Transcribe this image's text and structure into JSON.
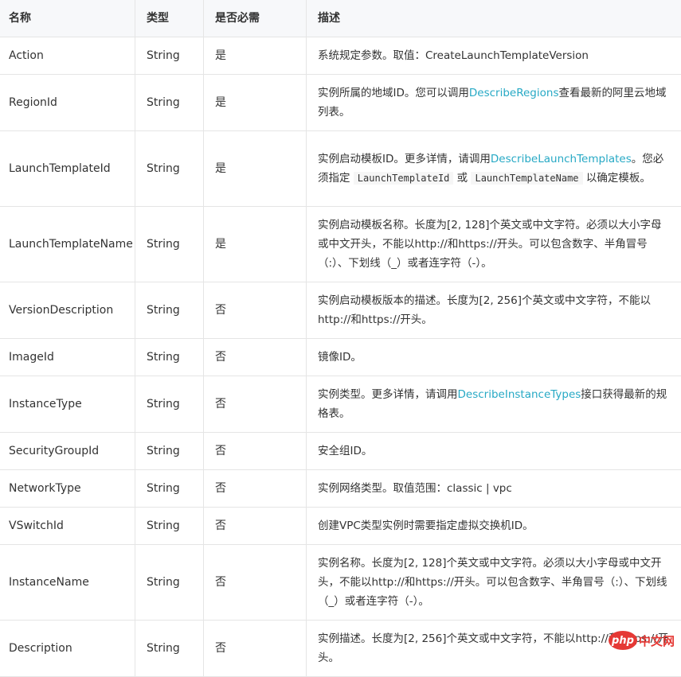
{
  "headers": [
    "名称",
    "类型",
    "是否必需",
    "描述"
  ],
  "rows": [
    {
      "name": "Action",
      "type": "String",
      "required": "是",
      "desc": [
        "系统规定参数。取值：CreateLaunchTemplateVersion"
      ]
    },
    {
      "name": "RegionId",
      "type": "String",
      "required": "是",
      "desc": [
        "实例所属的地域ID。您可以调用",
        {
          "link": "DescribeRegions"
        },
        "查看最新的阿里云地域列表。"
      ]
    },
    {
      "name": "LaunchTemplateId",
      "type": "String",
      "required": "是",
      "desc": [
        "实例启动模板ID。更多详情，请调用",
        {
          "link": "DescribeLaunchTemplates"
        },
        "。您必须指定 ",
        {
          "code": "LaunchTemplateId"
        },
        " 或 ",
        {
          "code": "LaunchTemplateName"
        },
        " 以确定模板。"
      ]
    },
    {
      "name": "LaunchTemplateName",
      "type": "String",
      "required": "是",
      "desc": [
        "实例启动模板名称。长度为[2, 128]个英文或中文字符。必须以大小字母或中文开头，不能以http://和https://开头。可以包含数字、半角冒号（:）、下划线（_）或者连字符（-）。"
      ]
    },
    {
      "name": "VersionDescription",
      "type": "String",
      "required": "否",
      "desc": [
        "实例启动模板版本的描述。长度为[2, 256]个英文或中文字符，不能以http://和https://开头。"
      ]
    },
    {
      "name": "ImageId",
      "type": "String",
      "required": "否",
      "desc": [
        "镜像ID。"
      ]
    },
    {
      "name": "InstanceType",
      "type": "String",
      "required": "否",
      "desc": [
        "实例类型。更多详情，请调用",
        {
          "link": "DescribeInstanceTypes"
        },
        "接口获得最新的规格表。"
      ]
    },
    {
      "name": "SecurityGroupId",
      "type": "String",
      "required": "否",
      "desc": [
        "安全组ID。"
      ]
    },
    {
      "name": "NetworkType",
      "type": "String",
      "required": "否",
      "desc": [
        "实例网络类型。取值范围：classic | vpc"
      ]
    },
    {
      "name": "VSwitchId",
      "type": "String",
      "required": "否",
      "desc": [
        "创建VPC类型实例时需要指定虚拟交换机ID。"
      ]
    },
    {
      "name": "InstanceName",
      "type": "String",
      "required": "否",
      "desc": [
        "实例名称。长度为[2, 128]个英文或中文字符。必须以大小字母或中文开头，不能以http://和https://开头。可以包含数字、半角冒号（:）、下划线（_）或者连字符（-）。"
      ]
    },
    {
      "name": "Description",
      "type": "String",
      "required": "否",
      "desc": [
        "实例描述。长度为[2, 256]个英文或中文字符，不能以http://和https://开头。"
      ]
    }
  ],
  "watermark": {
    "logo": "php",
    "text": "中文网"
  },
  "colors": {
    "link": "#27a9c5",
    "border": "#e5e5e5",
    "header_bg": "#f7f8fa"
  }
}
